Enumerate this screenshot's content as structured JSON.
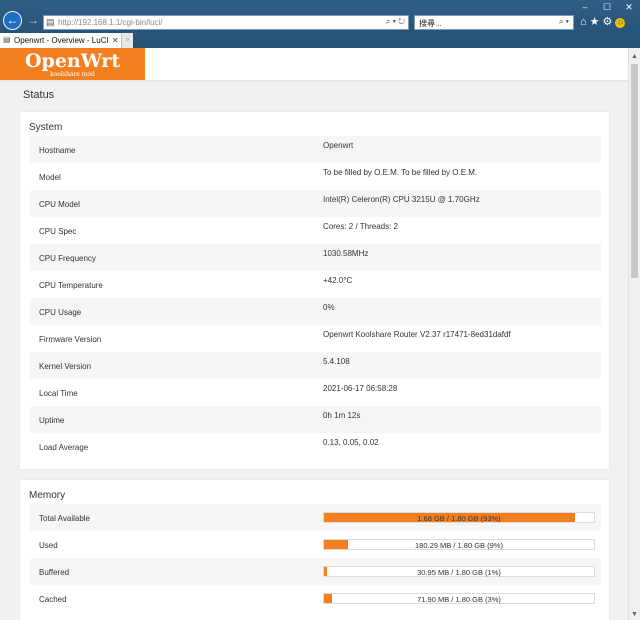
{
  "browser": {
    "url_host": "http://192.168.1.1",
    "url_path": "/cgi-bin/luci/",
    "search_placeholder": "搜尋...",
    "tab_title": "Openwrt - Overview - LuCI",
    "icons": [
      "back-arrow-icon",
      "forward-arrow-icon",
      "page-icon",
      "search-icon",
      "refresh-icon",
      "home-icon",
      "star-icon",
      "gear-icon",
      "smiley-icon",
      "minimize-icon",
      "maximize-icon",
      "close-icon",
      "new-tab-icon"
    ]
  },
  "logo": {
    "brand": "OpenWrt",
    "sub": "koolshare mod",
    "color": "#f47f20"
  },
  "page": {
    "heading": "Status"
  },
  "system": {
    "title": "System",
    "rows": [
      {
        "label": "Hostname",
        "value": "Openwrt"
      },
      {
        "label": "Model",
        "value": "To be filled by O.E.M. To be filled by O.E.M."
      },
      {
        "label": "CPU Model",
        "value": "Intel(R) Celeron(R) CPU 3215U @ 1.70GHz"
      },
      {
        "label": "CPU Spec",
        "value": "Cores: 2 / Threads: 2"
      },
      {
        "label": "CPU Frequency",
        "value": "1030.58MHz"
      },
      {
        "label": "CPU Temperature",
        "value": "+42.0°C"
      },
      {
        "label": "CPU Usage",
        "value": "0%"
      },
      {
        "label": "Firmware Version",
        "value": "Openwrt Koolshare Router V2.37 r17471-8ed31dafdf"
      },
      {
        "label": "Kernel Version",
        "value": "5.4.108"
      },
      {
        "label": "Local Time",
        "value": "2021-06-17 06:58:28"
      },
      {
        "label": "Uptime",
        "value": "0h 1m 12s"
      },
      {
        "label": "Load Average",
        "value": "0.13, 0.05, 0.02"
      }
    ]
  },
  "memory": {
    "title": "Memory",
    "rows": [
      {
        "label": "Total Available",
        "text": "1.68 GB / 1.80 GB (93%)",
        "percent": 93
      },
      {
        "label": "Used",
        "text": "180.29 MB / 1.80 GB (9%)",
        "percent": 9
      },
      {
        "label": "Buffered",
        "text": "30.95 MB / 1.80 GB (1%)",
        "percent": 1
      },
      {
        "label": "Cached",
        "text": "71.90 MB / 1.80 GB (3%)",
        "percent": 3
      }
    ]
  }
}
